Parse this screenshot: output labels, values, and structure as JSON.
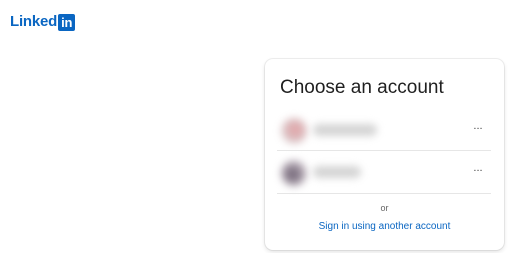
{
  "logo": {
    "word": "Linked",
    "box": "in"
  },
  "card": {
    "title": "Choose an account",
    "accounts": [
      {
        "more": "..."
      },
      {
        "more": "..."
      }
    ],
    "or_label": "or",
    "signin_link": "Sign in using another account"
  },
  "colors": {
    "brand": "#0a66c2",
    "text": "#1f1f1f",
    "muted": "#666666"
  },
  "icons": {
    "more": "more-icon"
  }
}
